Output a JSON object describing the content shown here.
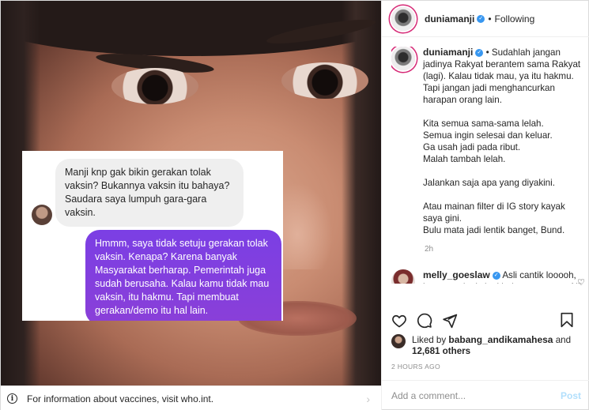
{
  "media": {
    "dm_incoming": "Manji knp gak bikin gerakan tolak vaksin? Bukannya vaksin itu bahaya? Saudara saya lumpuh gara-gara vaksin.",
    "dm_outgoing": "Hmmm, saya tidak setuju gerakan tolak vaksin. Kenapa? Karena banyak Masyarakat berharap. Pemerintah juga sudah berusaha. Kalau kamu tidak mau vaksin, itu hakmu. Tapi membuat gerakan/demo itu hal lain.",
    "info_text": "For information about vaccines, visit who.int."
  },
  "header": {
    "username": "duniamanji",
    "separator": "•",
    "follow_status": "Following"
  },
  "caption": {
    "username": "duniamanji",
    "lead": "• Sudahlah jangan jadinya Rakyat berantem sama Rakyat (lagi). Kalau tidak mau, ya itu hakmu. Tapi jangan jadi menghancurkan harapan orang lain.",
    "p2": "Kita semua sama-sama lelah.\nSemua ingin selesai dan keluar.\nGa usah jadi pada ribut.\nMalah tambah lelah.",
    "p3": "Jalankan saja apa yang diyakini.",
    "p4": "Atau mainan filter di IG story kayak saya gini.\nBulu mata jadi lentik banget, Bund.",
    "time": "2h"
  },
  "comment": {
    "username": "melly_goeslaw",
    "text": "Asli cantik looooh, kurang selapis lagi bulu matany nya Nji 😅"
  },
  "likes": {
    "prefix": "Liked by",
    "user": "babang_andikamahesa",
    "and": "and",
    "count": "12,681 others"
  },
  "post_time": "2 HOURS AGO",
  "add_comment": {
    "placeholder": "Add a comment...",
    "post_label": "Post"
  }
}
